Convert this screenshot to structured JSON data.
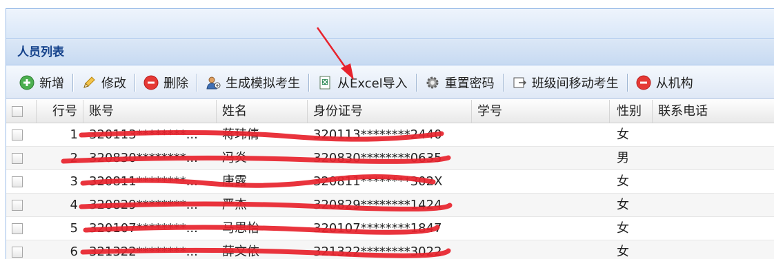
{
  "panel": {
    "title": "人员列表"
  },
  "toolbar": {
    "buttons": [
      {
        "label": "新增",
        "icon": "add-icon"
      },
      {
        "label": "修改",
        "icon": "pencil-icon"
      },
      {
        "label": "删除",
        "icon": "delete-icon"
      },
      {
        "label": "生成模拟考生",
        "icon": "user-icon"
      },
      {
        "label": "从Excel导入",
        "icon": "excel-icon"
      },
      {
        "label": "重置密码",
        "icon": "gear-icon"
      },
      {
        "label": "班级间移动考生",
        "icon": "move-icon"
      },
      {
        "label": "从机构",
        "icon": "remove-icon"
      }
    ]
  },
  "grid": {
    "headers": {
      "no": "行号",
      "account": "账号",
      "name": "姓名",
      "id_card": "身份证号",
      "student_no": "学号",
      "gender": "性别",
      "phone": "联系电话"
    },
    "rows": [
      {
        "no": "1",
        "account": "320113********...",
        "name": "蒋玮倩",
        "id_card": "320113********2440",
        "gender": "女"
      },
      {
        "no": "2",
        "account": "320830********...",
        "name": "冯炎",
        "id_card": "320830********0635",
        "gender": "男"
      },
      {
        "no": "3",
        "account": "320811********...",
        "name": "唐露",
        "id_card": "320811********302X",
        "gender": "女"
      },
      {
        "no": "4",
        "account": "320829********...",
        "name": "严杰",
        "id_card": "320829********1424",
        "gender": "女"
      },
      {
        "no": "5",
        "account": "320107********...",
        "name": "马思怡",
        "id_card": "320107********1847",
        "gender": "女"
      },
      {
        "no": "6",
        "account": "321322********...",
        "name": "薛文依",
        "id_card": "321322********3022",
        "gender": "女"
      }
    ]
  },
  "annotation": {
    "color": "#e8232d"
  }
}
